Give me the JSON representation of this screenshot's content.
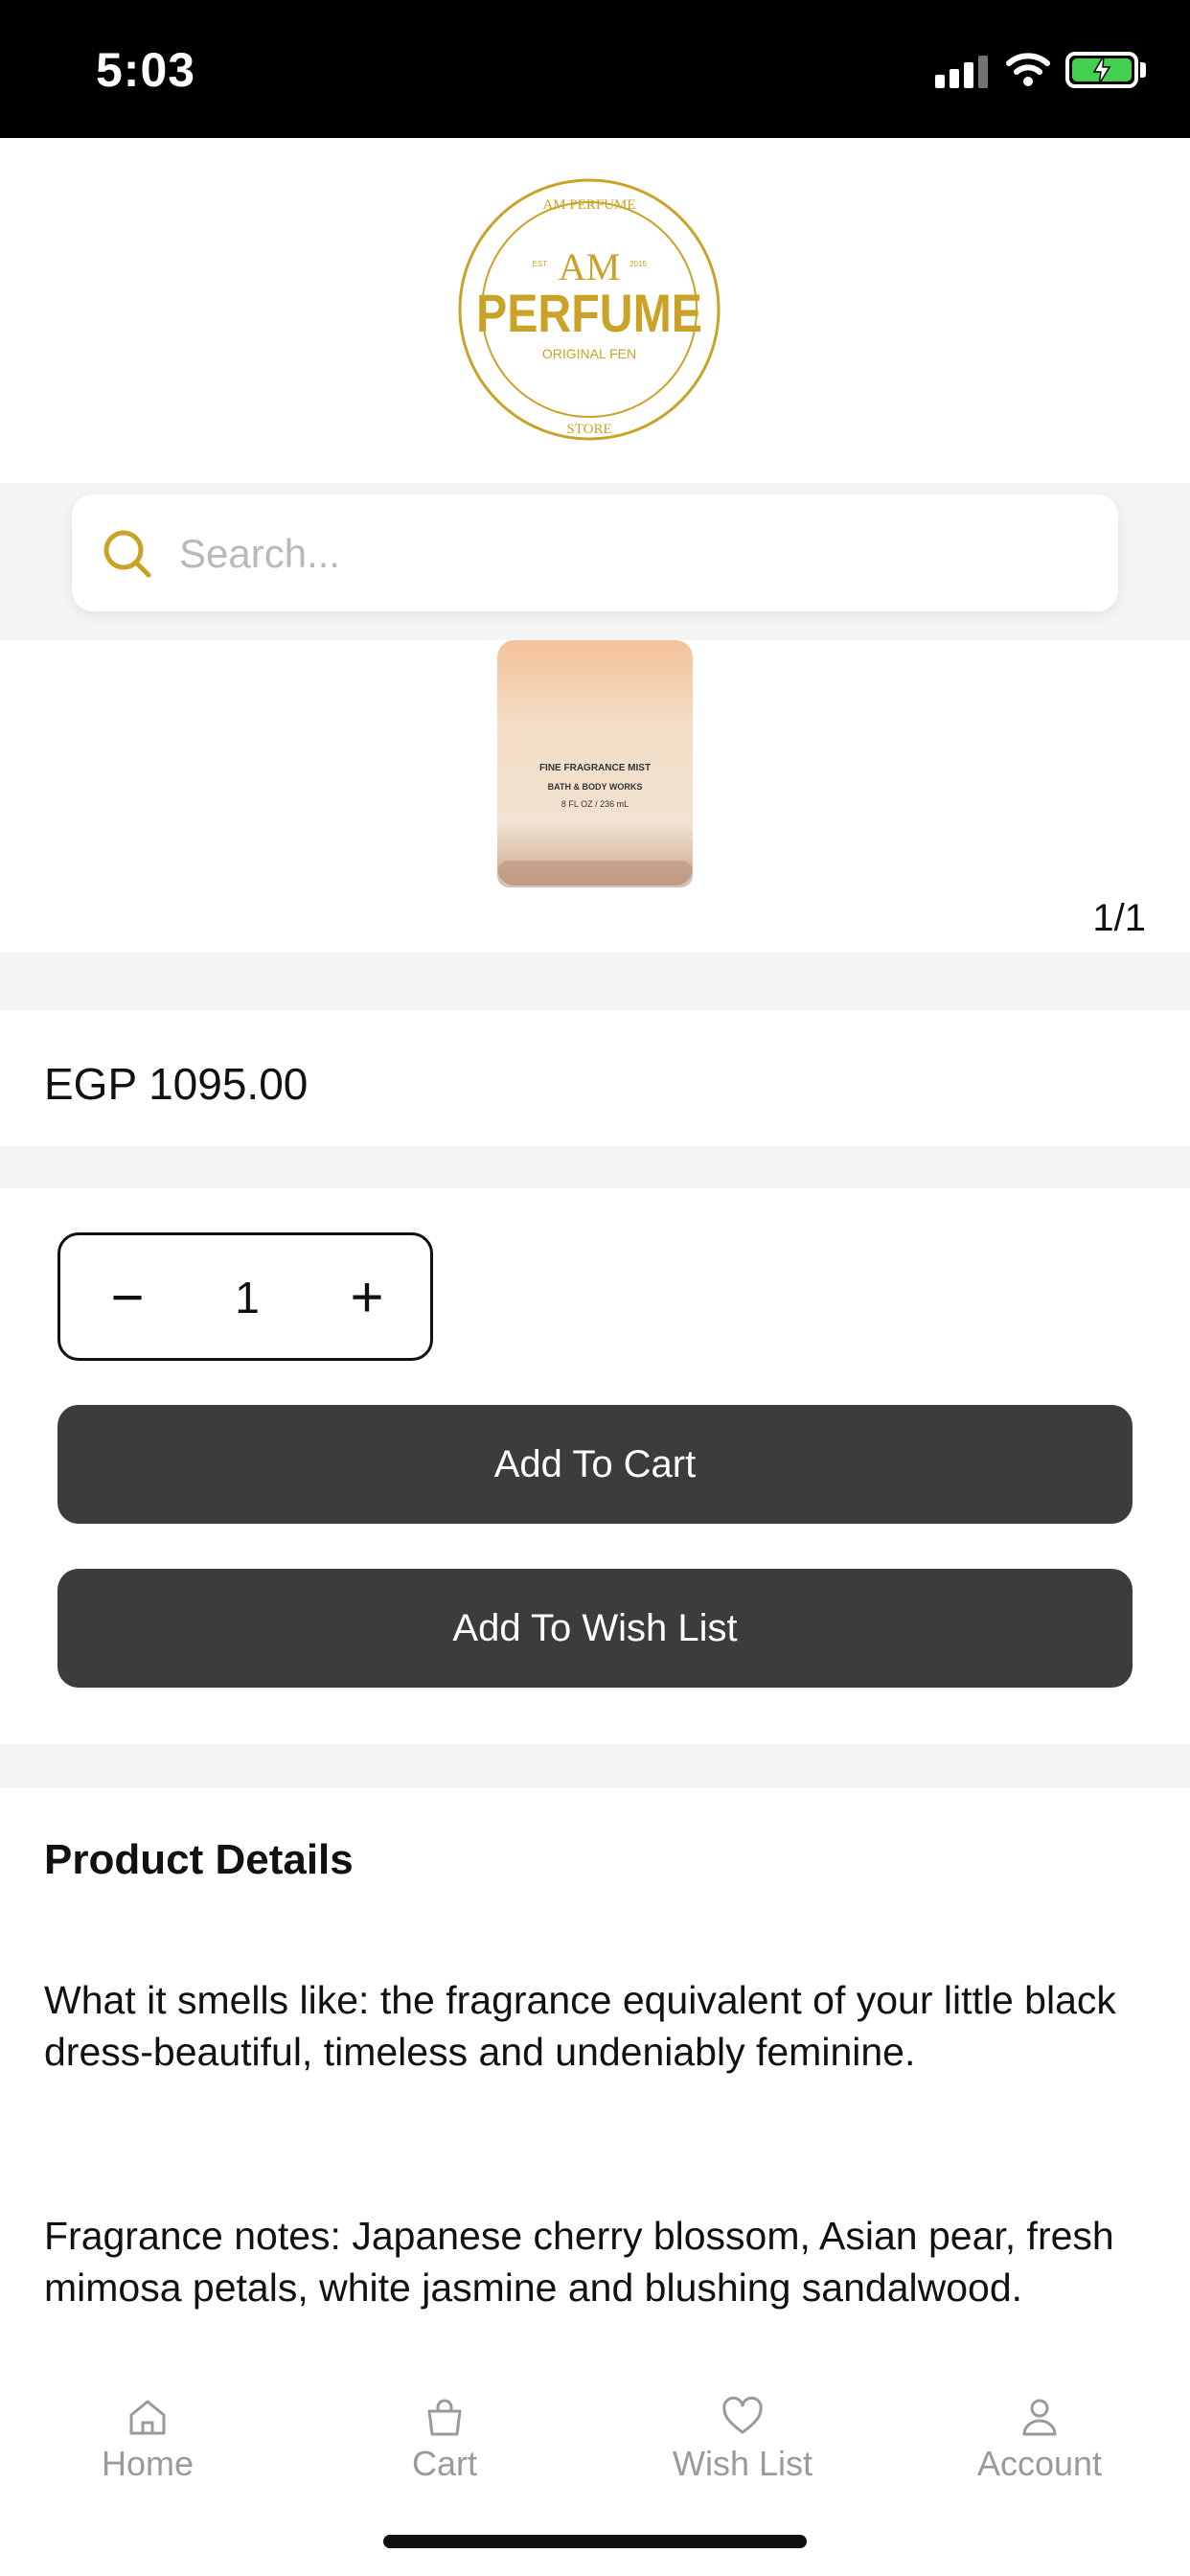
{
  "status_bar": {
    "time": "5:03"
  },
  "brand": {
    "top_text": "AM PERFUME",
    "monogram": "AM",
    "year_left": "EST.",
    "year_right": "2015",
    "name": "PERFUME",
    "tagline": "ORIGINAL FEN",
    "bottom_text": "STORE",
    "gold": "#c9a227"
  },
  "search": {
    "placeholder": "Search..."
  },
  "gallery": {
    "pager": "1/1",
    "label_lines": [
      "FINE FRAGRANCE MIST",
      "BATH & BODY WORKS",
      "8 FL OZ / 236 mL"
    ]
  },
  "product": {
    "price": "EGP 1095.00"
  },
  "quantity": {
    "minus": "−",
    "value": "1",
    "plus": "+"
  },
  "buttons": {
    "add_to_cart": "Add To Cart",
    "add_to_wishlist": "Add To Wish List"
  },
  "details": {
    "title": "Product Details",
    "paragraph1": "What it smells like: the fragrance equivalent of your little black dress-beautiful, timeless and undeniably feminine.",
    "paragraph2": "Fragrance notes: Japanese cherry blossom, Asian pear, fresh mimosa petals, white jasmine and blushing sandalwood."
  },
  "tabbar": {
    "home": {
      "label": "Home",
      "icon": "home-icon"
    },
    "cart": {
      "label": "Cart",
      "icon": "bag-icon"
    },
    "wishlist": {
      "label": "Wish List",
      "icon": "heart-icon"
    },
    "account": {
      "label": "Account",
      "icon": "person-icon"
    }
  },
  "colors": {
    "button_bg": "#3c3c3c",
    "band_bg": "#f5f5f5",
    "accent_gold": "#c9a227",
    "battery_green": "#43d04f"
  }
}
